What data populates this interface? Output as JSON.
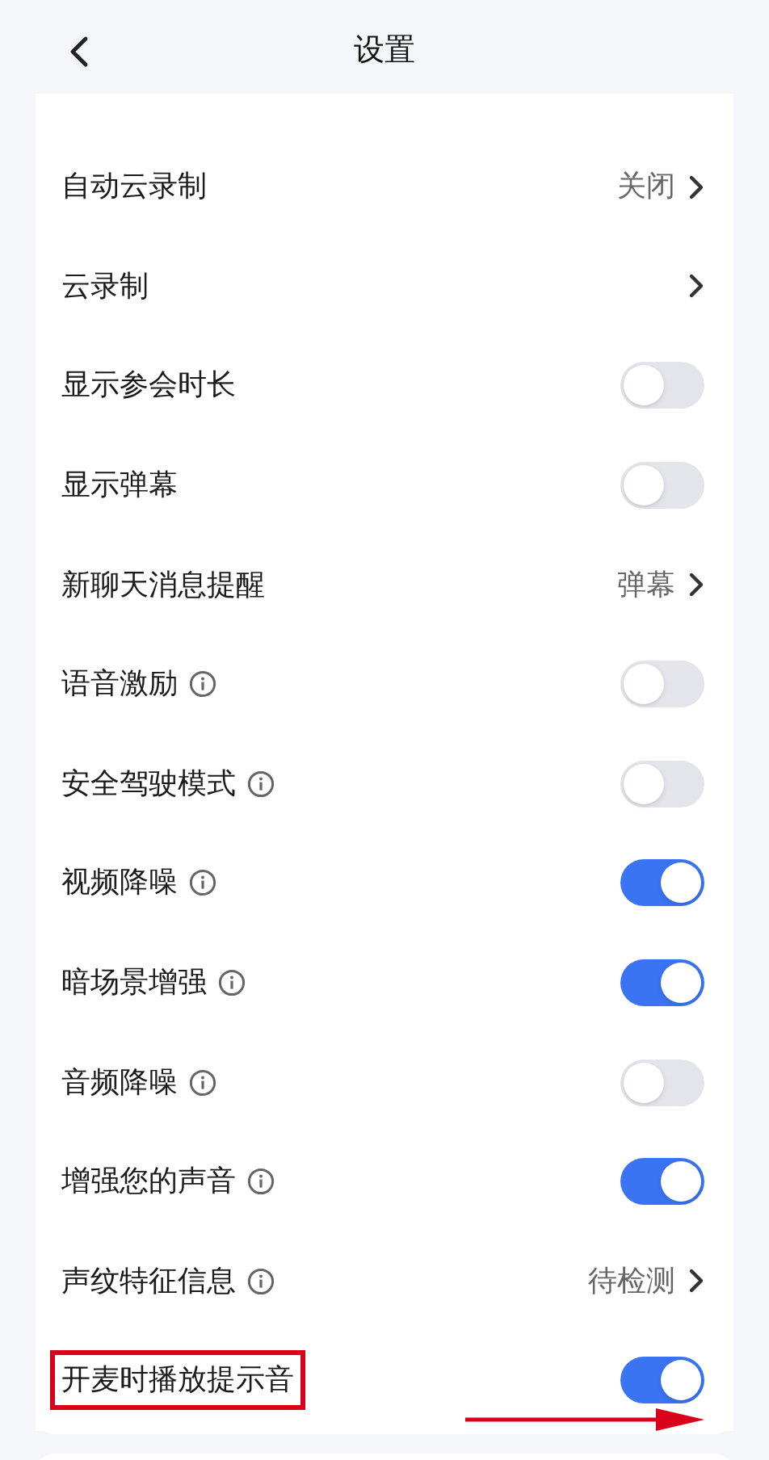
{
  "header": {
    "title": "设置"
  },
  "rows": [
    {
      "kind": "value",
      "label": "自动云录制",
      "value": "关闭",
      "info": false,
      "highlighted": false
    },
    {
      "kind": "link",
      "label": "云录制",
      "info": false,
      "highlighted": false
    },
    {
      "kind": "toggle",
      "label": "显示参会时长",
      "on": false,
      "info": false,
      "highlighted": false
    },
    {
      "kind": "toggle",
      "label": "显示弹幕",
      "on": false,
      "info": false,
      "highlighted": false
    },
    {
      "kind": "value",
      "label": "新聊天消息提醒",
      "value": "弹幕",
      "info": false,
      "highlighted": false
    },
    {
      "kind": "toggle",
      "label": "语音激励",
      "on": false,
      "info": true,
      "highlighted": false
    },
    {
      "kind": "toggle",
      "label": "安全驾驶模式",
      "on": false,
      "info": true,
      "highlighted": false
    },
    {
      "kind": "toggle",
      "label": "视频降噪",
      "on": true,
      "info": true,
      "highlighted": false
    },
    {
      "kind": "toggle",
      "label": "暗场景增强",
      "on": true,
      "info": true,
      "highlighted": false
    },
    {
      "kind": "toggle",
      "label": "音频降噪",
      "on": false,
      "info": true,
      "highlighted": false
    },
    {
      "kind": "toggle",
      "label": "增强您的声音",
      "on": true,
      "info": true,
      "highlighted": false
    },
    {
      "kind": "value",
      "label": "声纹特征信息",
      "value": "待检测",
      "info": true,
      "highlighted": false
    },
    {
      "kind": "toggle",
      "label": "开麦时播放提示音",
      "on": true,
      "info": false,
      "highlighted": true
    }
  ],
  "annotation": {
    "arrow": true
  }
}
